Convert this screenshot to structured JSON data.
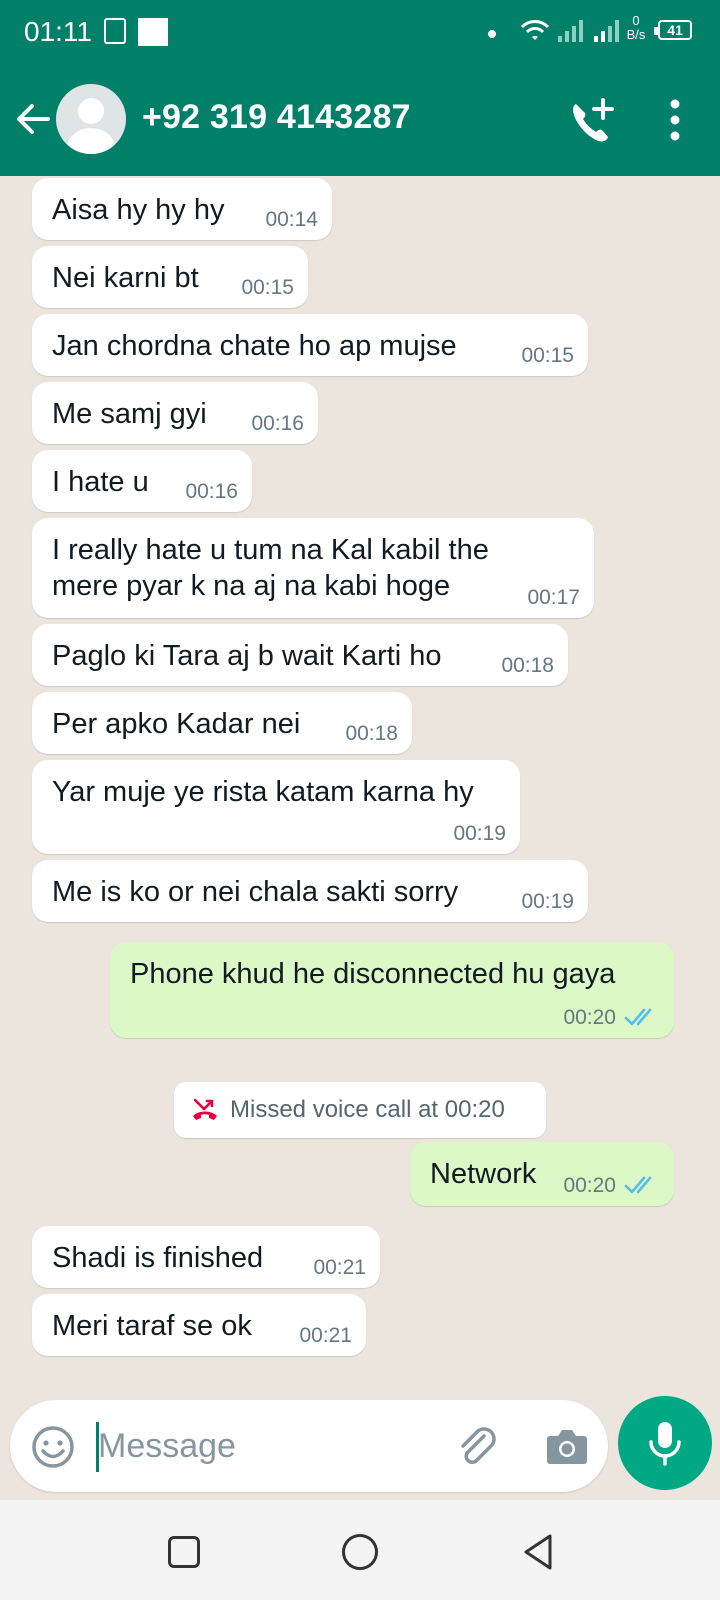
{
  "status_bar": {
    "time": "01:11",
    "net_speed_value": "0",
    "net_speed_unit": "B/s",
    "battery": "41"
  },
  "header": {
    "contact_name": "+92 319 4143287",
    "icons": [
      "back-arrow-icon",
      "avatar",
      "add-call-icon",
      "more-vert-icon"
    ]
  },
  "messages": [
    {
      "dir": "in",
      "text": "Aisa hy hy hy",
      "time": "00:14"
    },
    {
      "dir": "in",
      "text": "Nei karni bt",
      "time": "00:15"
    },
    {
      "dir": "in",
      "text": "Jan chordna chate ho ap mujse",
      "time": "00:15"
    },
    {
      "dir": "in",
      "text": "Me samj gyi",
      "time": "00:16"
    },
    {
      "dir": "in",
      "text": "I hate u",
      "time": "00:16"
    },
    {
      "dir": "in",
      "line1": "I really hate u tum na Kal kabil the",
      "line2": "mere pyar k na aj na kabi hoge",
      "time": "00:17"
    },
    {
      "dir": "in",
      "text": "Paglo ki Tara aj b wait Karti ho",
      "time": "00:18"
    },
    {
      "dir": "in",
      "text": "Per apko Kadar nei",
      "time": "00:18"
    },
    {
      "dir": "in",
      "text": "Yar muje ye rista katam karna hy",
      "time": "00:19"
    },
    {
      "dir": "in",
      "text": "Me is ko or nei chala sakti sorry",
      "time": "00:19"
    },
    {
      "dir": "out",
      "text": "Phone khud he disconnected hu gaya",
      "time": "00:20",
      "status": "read"
    },
    {
      "dir": "out",
      "text": "Network",
      "time": "00:20",
      "status": "read"
    },
    {
      "dir": "in",
      "text": "Shadi is finished",
      "time": "00:21"
    },
    {
      "dir": "in",
      "text": "Meri taraf se ok",
      "time": "00:21"
    }
  ],
  "system_messages": {
    "missed_call": "Missed voice call at 00:20"
  },
  "composer": {
    "placeholder": "Message"
  },
  "colors": {
    "header": "#008069",
    "chat_bg": "#ece5dd",
    "outgoing_bubble": "#dcf8c6",
    "read_ticks": "#53bdeb",
    "mic_button": "#00a884",
    "missed_call_icon": "#ea0038"
  }
}
